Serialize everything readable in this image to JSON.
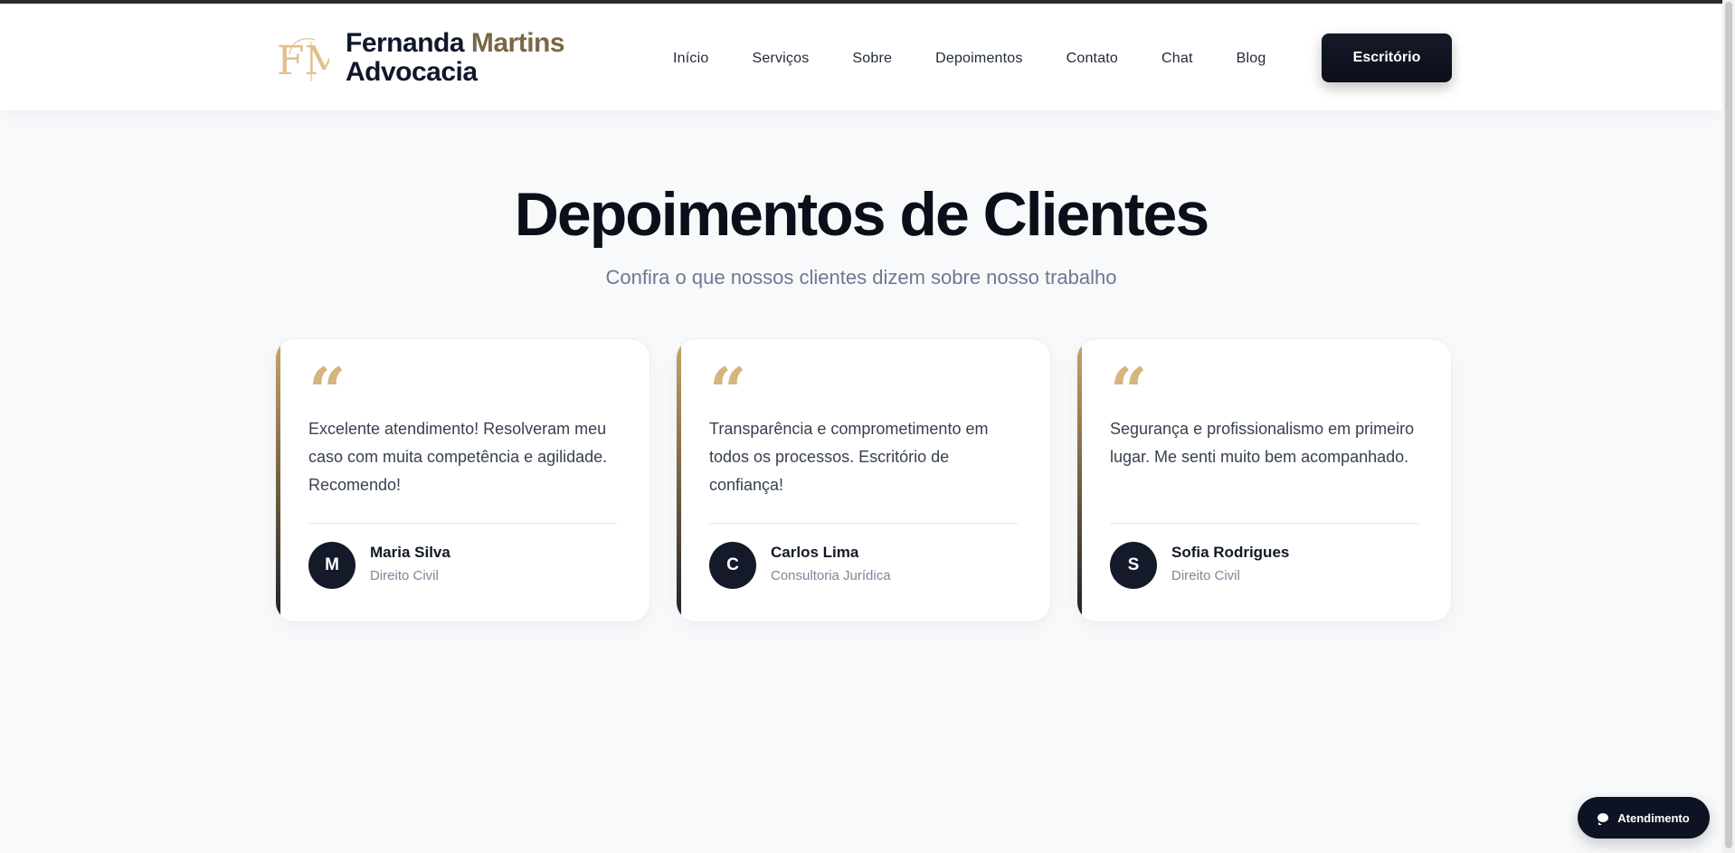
{
  "brand": {
    "name_dark": "Fernanda",
    "name_gold": "Martins",
    "line2": "Advocacia",
    "logo_letters": "FM"
  },
  "nav": {
    "items": [
      "Início",
      "Serviços",
      "Sobre",
      "Depoimentos",
      "Contato",
      "Chat",
      "Blog"
    ],
    "cta_label": "Escritório"
  },
  "hero": {
    "title": "Depoimentos de Clientes",
    "subtitle": "Confira o que nossos clientes dizem sobre nosso trabalho"
  },
  "testimonials": [
    {
      "quote_mark": "“",
      "text": "Excelente atendimento! Resolveram meu caso com muita competência e agilidade. Recomendo!",
      "initial": "M",
      "name": "Maria Silva",
      "area": "Direito Civil"
    },
    {
      "quote_mark": "“",
      "text": "Transparência e comprometimento em todos os processos. Escritório de confiança!",
      "initial": "C",
      "name": "Carlos Lima",
      "area": "Consultoria Jurídica"
    },
    {
      "quote_mark": "“",
      "text": "Segurança e profissionalismo em primeiro lugar. Me senti muito bem acompanhado.",
      "initial": "S",
      "name": "Sofia Rodrigues",
      "area": "Direito Civil"
    }
  ],
  "chat_widget": {
    "label": "Atendimento",
    "icon": "chat-bubble-icon"
  },
  "colors": {
    "gold": "#d6b47e",
    "brand_gold_text": "#7a6745",
    "navy": "#0d1322"
  }
}
